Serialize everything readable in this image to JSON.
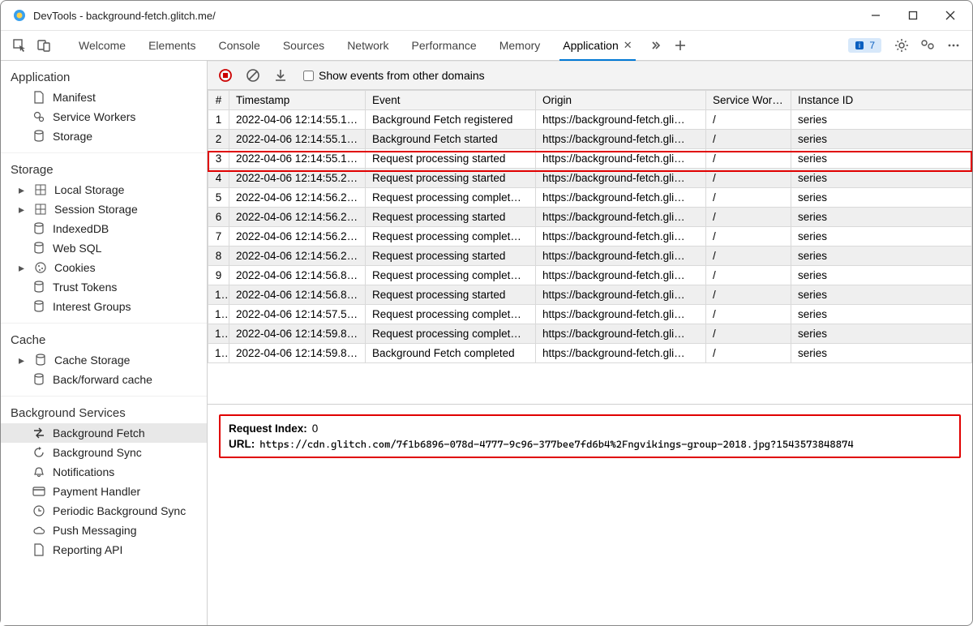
{
  "window": {
    "title": "DevTools - background-fetch.glitch.me/"
  },
  "tabs": {
    "list": [
      {
        "label": "Welcome"
      },
      {
        "label": "Elements"
      },
      {
        "label": "Console"
      },
      {
        "label": "Sources"
      },
      {
        "label": "Network"
      },
      {
        "label": "Performance"
      },
      {
        "label": "Memory"
      },
      {
        "label": "Application"
      }
    ],
    "issues_badge": "7"
  },
  "sidebar": {
    "application": {
      "title": "Application",
      "items": {
        "manifest": "Manifest",
        "service_workers": "Service Workers",
        "storage": "Storage"
      }
    },
    "storage": {
      "title": "Storage",
      "items": {
        "local": "Local Storage",
        "session": "Session Storage",
        "indexeddb": "IndexedDB",
        "websql": "Web SQL",
        "cookies": "Cookies",
        "trust": "Trust Tokens",
        "interest": "Interest Groups"
      }
    },
    "cache": {
      "title": "Cache",
      "items": {
        "cache_storage": "Cache Storage",
        "bfcache": "Back/forward cache"
      }
    },
    "background": {
      "title": "Background Services",
      "items": {
        "bgfetch": "Background Fetch",
        "bgsync": "Background Sync",
        "notifications": "Notifications",
        "payment": "Payment Handler",
        "periodic": "Periodic Background Sync",
        "push": "Push Messaging",
        "reporting": "Reporting API"
      }
    }
  },
  "toolbar": {
    "show_other_label": "Show events from other domains"
  },
  "table": {
    "cols": {
      "idx": "#",
      "timestamp": "Timestamp",
      "event": "Event",
      "origin": "Origin",
      "sw": "Service Wor…",
      "instance": "Instance ID"
    },
    "rows": [
      {
        "idx": "1",
        "ts": "2022-04-06 12:14:55.1…",
        "evt": "Background Fetch registered",
        "origin": "https://background-fetch.gli…",
        "sw": "/",
        "inst": "series"
      },
      {
        "idx": "2",
        "ts": "2022-04-06 12:14:55.1…",
        "evt": "Background Fetch started",
        "origin": "https://background-fetch.gli…",
        "sw": "/",
        "inst": "series"
      },
      {
        "idx": "3",
        "ts": "2022-04-06 12:14:55.1…",
        "evt": "Request processing started",
        "origin": "https://background-fetch.gli…",
        "sw": "/",
        "inst": "series"
      },
      {
        "idx": "4",
        "ts": "2022-04-06 12:14:55.2…",
        "evt": "Request processing started",
        "origin": "https://background-fetch.gli…",
        "sw": "/",
        "inst": "series"
      },
      {
        "idx": "5",
        "ts": "2022-04-06 12:14:56.2…",
        "evt": "Request processing complet…",
        "origin": "https://background-fetch.gli…",
        "sw": "/",
        "inst": "series"
      },
      {
        "idx": "6",
        "ts": "2022-04-06 12:14:56.2…",
        "evt": "Request processing started",
        "origin": "https://background-fetch.gli…",
        "sw": "/",
        "inst": "series"
      },
      {
        "idx": "7",
        "ts": "2022-04-06 12:14:56.2…",
        "evt": "Request processing complet…",
        "origin": "https://background-fetch.gli…",
        "sw": "/",
        "inst": "series"
      },
      {
        "idx": "8",
        "ts": "2022-04-06 12:14:56.2…",
        "evt": "Request processing started",
        "origin": "https://background-fetch.gli…",
        "sw": "/",
        "inst": "series"
      },
      {
        "idx": "9",
        "ts": "2022-04-06 12:14:56.8…",
        "evt": "Request processing complet…",
        "origin": "https://background-fetch.gli…",
        "sw": "/",
        "inst": "series"
      },
      {
        "idx": "1..",
        "ts": "2022-04-06 12:14:56.8…",
        "evt": "Request processing started",
        "origin": "https://background-fetch.gli…",
        "sw": "/",
        "inst": "series"
      },
      {
        "idx": "1..",
        "ts": "2022-04-06 12:14:57.5…",
        "evt": "Request processing complet…",
        "origin": "https://background-fetch.gli…",
        "sw": "/",
        "inst": "series"
      },
      {
        "idx": "1..",
        "ts": "2022-04-06 12:14:59.8…",
        "evt": "Request processing complet…",
        "origin": "https://background-fetch.gli…",
        "sw": "/",
        "inst": "series"
      },
      {
        "idx": "1..",
        "ts": "2022-04-06 12:14:59.8…",
        "evt": "Background Fetch completed",
        "origin": "https://background-fetch.gli…",
        "sw": "/",
        "inst": "series"
      }
    ]
  },
  "details": {
    "request_index_label": "Request Index:",
    "request_index_value": "0",
    "url_label": "URL:",
    "url_value": "https://cdn.glitch.com/7f1b6896-078d-4777-9c96-377bee7fd6b4%2Fngvikings-group-2018.jpg?1543573848874"
  }
}
